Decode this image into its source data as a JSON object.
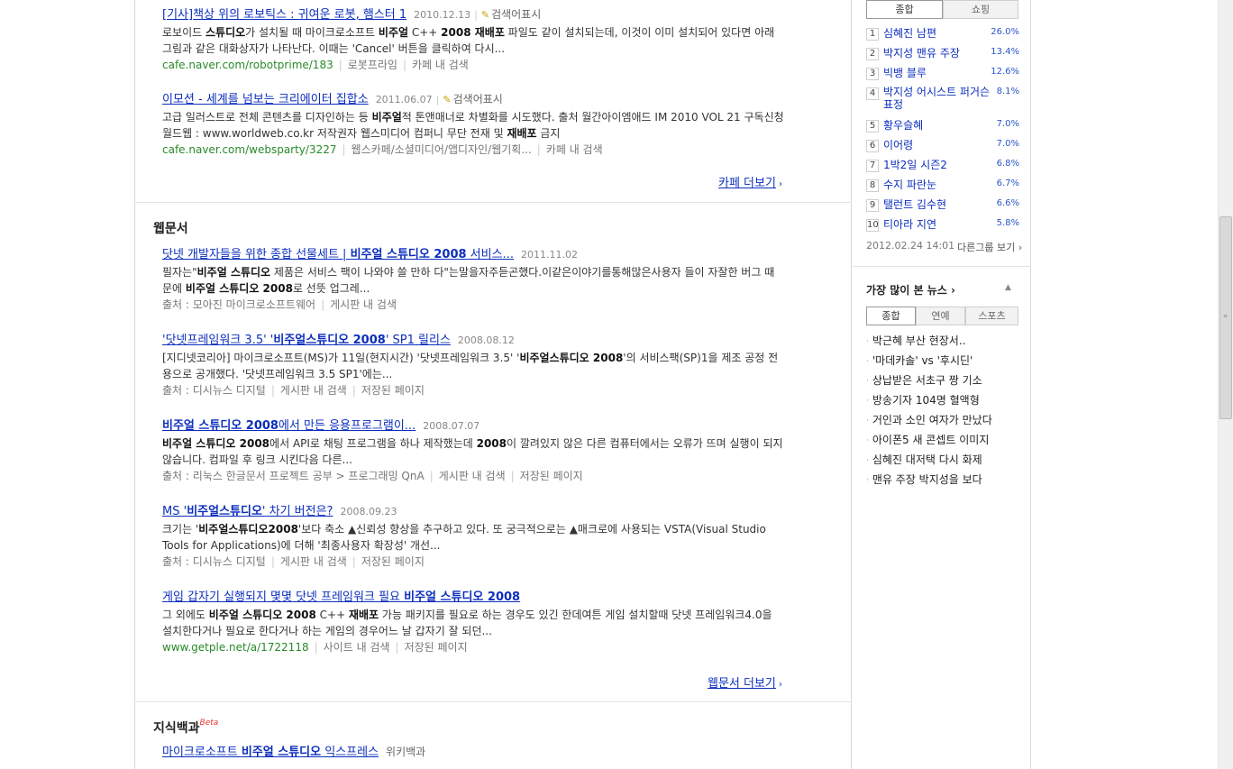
{
  "cafe": {
    "results": [
      {
        "title_prefix": "[기사]책상 위의 로보틱스 : 귀여운 로봇, 햄스터 1",
        "date": "2010.12.13",
        "badge": "검색어표시",
        "desc_1": "로보이드 ",
        "desc_b1": "스튜디오",
        "desc_2": "가 설치될 때 마이크로소프트 ",
        "desc_b2": "비주얼",
        "desc_3": " C++ ",
        "desc_b3": "2008 재배포",
        "desc_4": " 파일도 같이 설치되는데, 이것이 이미 설치되어 있다면 아래 그림과 같은 대화상자가 나타난다. 이때는 'Cancel' 버튼을 클릭하여 다시...",
        "url": "cafe.naver.com/robotprime/183",
        "source": "로봇프라임",
        "inner_search": "카페 내 검색"
      },
      {
        "title_prefix": "이모션 - 세계를 넘보는 크리에이터 집합소",
        "date": "2011.06.07",
        "badge": "검색어표시",
        "desc_1": "고급 일러스트로 전체 콘텐츠를 디자인하는 등 ",
        "desc_b1": "비주얼",
        "desc_2": "적 톤앤매너로 차별화를 시도했다. 출처 월간아이엠애드 IM 2010 VOL 21 구독신청 월드웹 : www.worldweb.co.kr 저작권자 웹스미디어 컴퍼니 무단 전재 및 ",
        "desc_b2": "재배포",
        "desc_3": " 금지",
        "url": "cafe.naver.com/websparty/3227",
        "source": "웹스카페/소셜미디어/앱디자인/웹기획...",
        "inner_search": "카페 내 검색"
      }
    ],
    "more": "카페 더보기"
  },
  "webdocs": {
    "heading": "웹문서",
    "results": [
      {
        "t1": "닷넷 개발자들을 위한 종합 선물세트 | ",
        "tb": "비주얼 스튜디오 2008",
        "t2": " 서비스...",
        "date": "2011.11.02",
        "d1": "필자는\"",
        "db1": "비주얼 스튜디오",
        "d2": " 제품은 서비스 팩이 나와야 쓸 만하 다\"는말을자주듣곤했다.이같은이야기를통해많은사용자 들이 자잘한 버그 때문에 ",
        "db2": "비주얼 스튜디오 2008",
        "d3": "로 선뜻 업그레...",
        "meta": [
          "출처 : 모아진 마이크로소프트웨어",
          "게시판 내 검색"
        ]
      },
      {
        "t1": "'닷넷프레임워크 3.5' '",
        "tb": "비주얼스튜디오 2008",
        "t2": "' SP1 릴리스",
        "date": "2008.08.12",
        "d1": "[지디넷코리아] 마이크로소프트(MS)가 11일(현지시간) '닷넷프레임워크 3.5' '",
        "db1": "비주얼스튜디오 2008",
        "d2": "'의 서비스팩(SP)1을 제조 공정 전용으로 공개했다. '닷넷프레임워크 3.5 SP1'에는...",
        "db2": "",
        "d3": "",
        "meta": [
          "출처 : 디시뉴스 디지털",
          "게시판 내 검색",
          "저장된 페이지"
        ]
      },
      {
        "t1": "",
        "tb": "비주얼 스튜디오 2008",
        "t2": "에서 만든 응용프로그램이...",
        "date": "2008.07.07",
        "d1": "",
        "db1": "비주얼 스튜디오 2008",
        "d2": "에서 API로 채팅 프로그램을 하나 제작했는데 ",
        "db2": "2008",
        "d3": "이 깔려있지 않은 다른 컴퓨터에서는 오류가 뜨며 실행이 되지 않습니다. 컴파일 후 링크 시킨다음 다른...",
        "meta": [
          "출처 : 리눅스 한글문서 프로젝트 공부 > 프로그래밍 QnA",
          "게시판 내 검색",
          "저장된 페이지"
        ]
      },
      {
        "t1": "MS '",
        "tb": "비주얼스튜디오",
        "t2": "' 차기 버전은?",
        "date": "2008.09.23",
        "d1": "크기는 '",
        "db1": "비주얼스튜디오2008",
        "d2": "'보다 축소 ▲신뢰성 향상을 추구하고 있다. 또 궁극적으로는 ▲매크로에 사용되는 VSTA(Visual Studio Tools for Applications)에 더해 '최종사용자 확장성' 개선...",
        "db2": "",
        "d3": "",
        "meta": [
          "출처 : 디시뉴스 디지털",
          "게시판 내 검색",
          "저장된 페이지"
        ]
      },
      {
        "t1": "게임 갑자기 실행되지 몇몇 닷넷 프레임워크 필요 ",
        "tb": "비주얼 스튜디오 2008",
        "t2": "",
        "date": "",
        "d1": "그 외에도 ",
        "db1": "비주얼 스튜디오 2008",
        "d2": " C++ ",
        "db2": "재배포",
        "d3": " 가능 패키지를 필요로 하는 경우도 있긴 한데여튼 게임 설치할때 닷넷 프레임워크4.0을 설치한다거나 필요로 한다거나 하는 게임의 경우어느 날 갑자기 잘 되던...",
        "url": "www.getple.net/a/1722118",
        "meta": [
          "사이트 내 검색",
          "저장된 페이지"
        ]
      }
    ],
    "more": "웹문서 더보기"
  },
  "encyclopedia": {
    "heading": "지식백과",
    "beta": "Beta",
    "first_t1": "마이크로소프트 ",
    "first_tb": "비주얼 스튜디오",
    "first_t2": " 익스프레스",
    "first_source": "위키백과"
  },
  "side": {
    "rank_tabs": [
      "종합",
      "쇼핑"
    ],
    "ranks": [
      {
        "num": "1",
        "name": "심혜진 남편",
        "pct": "26.0%"
      },
      {
        "num": "2",
        "name": "박지성 맨유 주장",
        "pct": "13.4%"
      },
      {
        "num": "3",
        "name": "빅뱅 블루",
        "pct": "12.6%"
      },
      {
        "num": "4",
        "name": "박지성 어시스트 퍼거슨 표정",
        "pct": "8.1%"
      },
      {
        "num": "5",
        "name": "황우슬혜",
        "pct": "7.0%"
      },
      {
        "num": "6",
        "name": "이어령",
        "pct": "7.0%"
      },
      {
        "num": "7",
        "name": "1박2일 시즌2",
        "pct": "6.8%"
      },
      {
        "num": "8",
        "name": "수지 파란눈",
        "pct": "6.7%"
      },
      {
        "num": "9",
        "name": "탤런트 김수현",
        "pct": "6.6%"
      },
      {
        "num": "10",
        "name": "티아라 지연",
        "pct": "5.8%"
      }
    ],
    "timestamp": "2012.02.24 14:01",
    "other_groups": "다른그룹 보기",
    "news_heading": "가장 많이 본 뉴스",
    "news_tabs": [
      "종합",
      "연예",
      "스포츠"
    ],
    "news": [
      "박근혜 부산 현장서..",
      "'마데카솔' vs '후시딘'",
      "상납받은 서초구 짱 기소",
      "방송기자 104명 혈액형",
      "거인과 소인 여자가 만났다",
      "아이폰5 새 콘셉트 이미지",
      "심혜진 대저택 다시 화제",
      "맨유 주장 박지성을 보다"
    ]
  }
}
